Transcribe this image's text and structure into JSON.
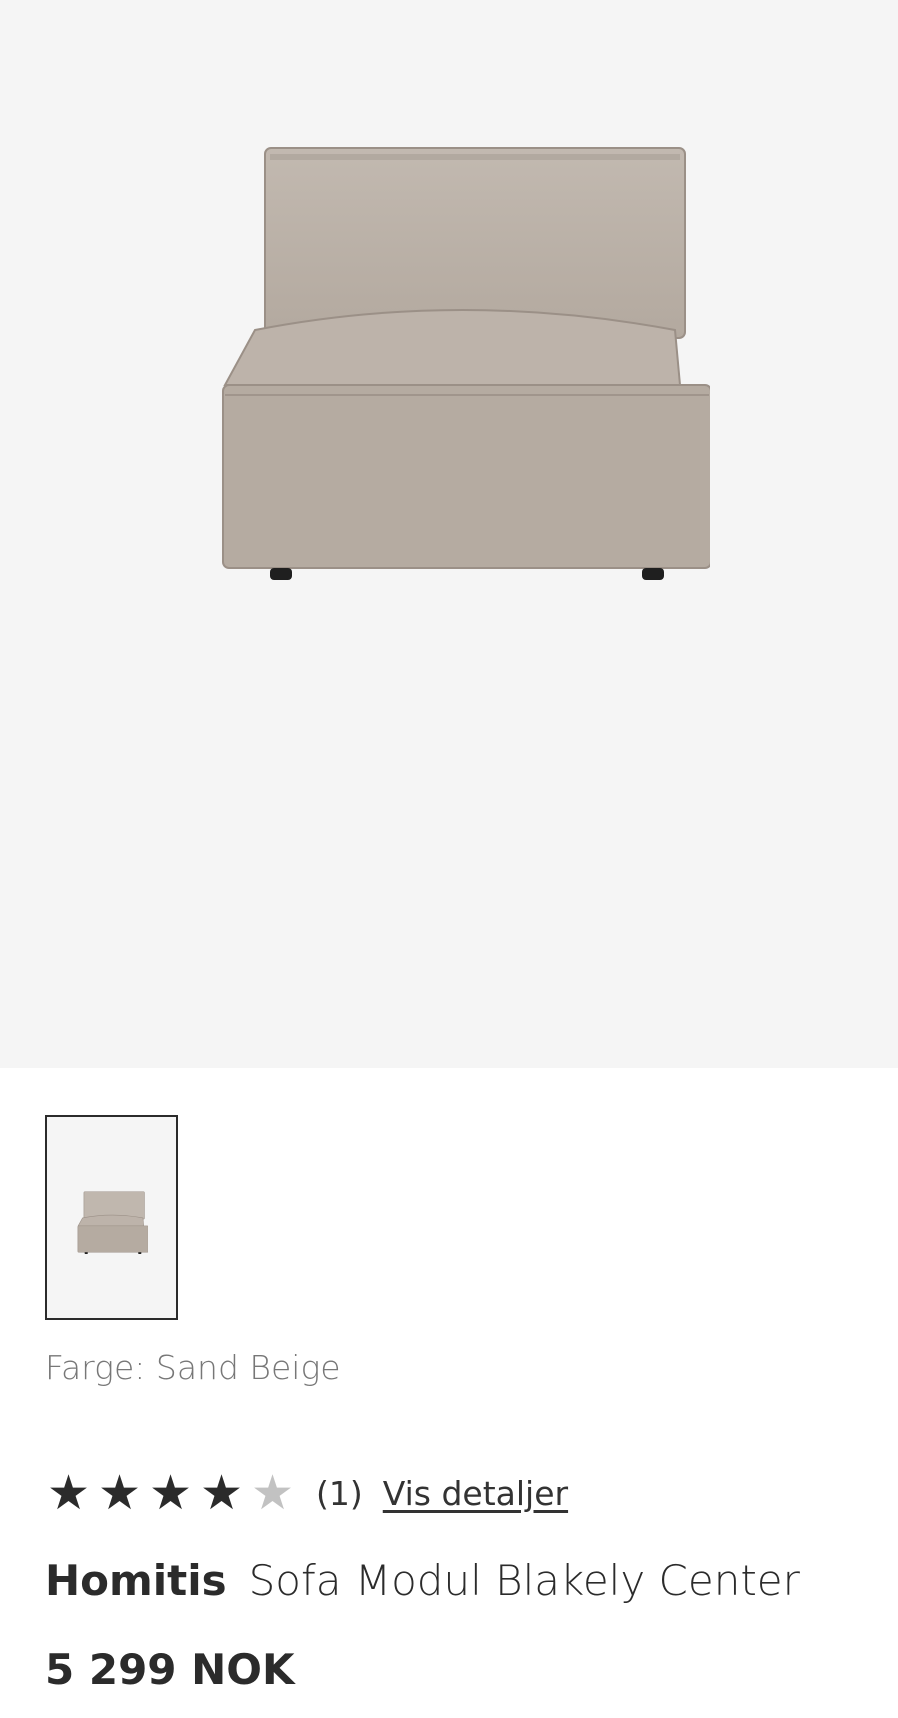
{
  "product": {
    "image_icon": "sofa-module-icon",
    "thumbnail_icon": "sofa-module-icon",
    "color_label": "Farge: Sand Beige",
    "rating": {
      "value": 4,
      "max": 5,
      "count_text": "(1)",
      "details_link": "Vis detaljer"
    },
    "brand": "Homitis",
    "name": "Sofa Modul Blakely Center",
    "price": "5 299 NOK"
  },
  "colors": {
    "hero_background": "#f5f5f5",
    "sofa_fabric": "#b8aea5",
    "star_filled": "#2b2b2b",
    "star_empty": "#c2c2c2"
  }
}
